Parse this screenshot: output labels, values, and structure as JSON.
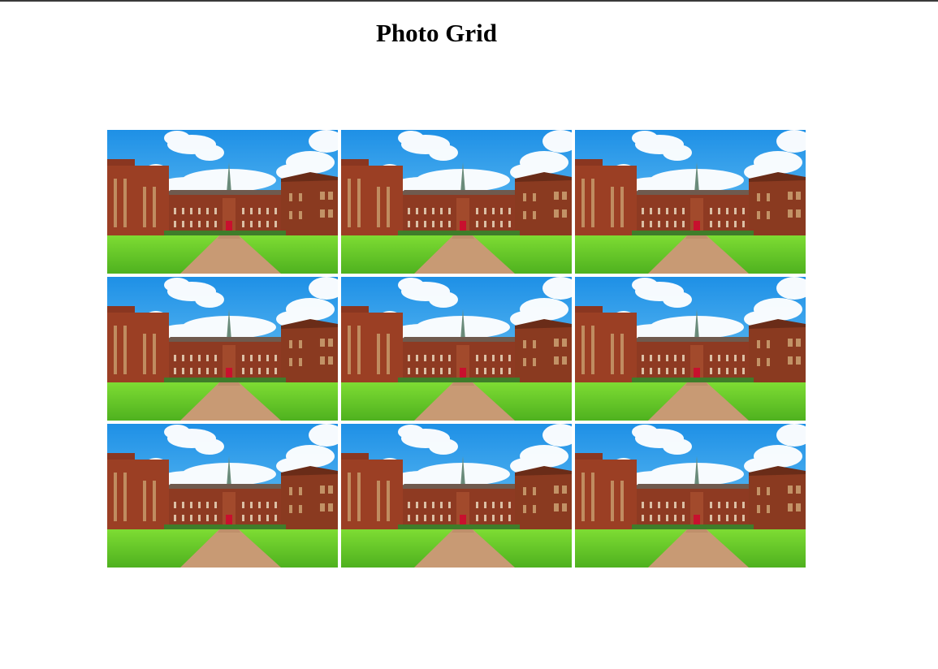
{
  "page": {
    "title": "Photo Grid"
  },
  "grid": {
    "rows": 3,
    "columns": 3,
    "photos": [
      {
        "subject": "brick-campus-building"
      },
      {
        "subject": "brick-campus-building"
      },
      {
        "subject": "brick-campus-building"
      },
      {
        "subject": "brick-campus-building"
      },
      {
        "subject": "brick-campus-building"
      },
      {
        "subject": "brick-campus-building"
      },
      {
        "subject": "brick-campus-building"
      },
      {
        "subject": "brick-campus-building"
      },
      {
        "subject": "brick-campus-building"
      }
    ]
  },
  "colors": {
    "sky": "#3aa6ea",
    "brick": "#8e3a22",
    "lawn": "#6ccf2a",
    "path": "#c89a74",
    "title_text": "#000000",
    "top_rule": "#3a3a3a"
  }
}
